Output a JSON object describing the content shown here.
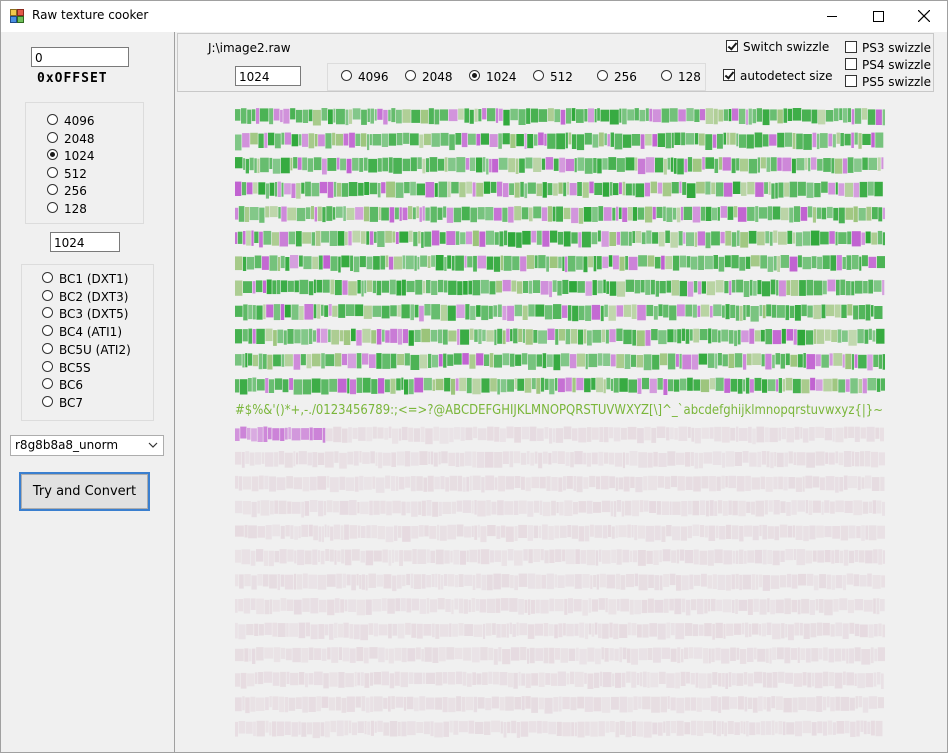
{
  "window": {
    "title": "Raw texture cooker"
  },
  "left": {
    "offset_value": "0",
    "offset_label": "0xOFFSET",
    "sizes": [
      "4096",
      "2048",
      "1024",
      "512",
      "256",
      "128"
    ],
    "selected_size": "1024",
    "size_value": "1024",
    "formats": [
      "BC1 (DXT1)",
      "BC2 (DXT3)",
      "BC3 (DXT5)",
      "BC4 (ATI1)",
      "BC5U (ATI2)",
      "BC5S",
      "BC6",
      "BC7"
    ],
    "pixel_format": "r8g8b8a8_unorm",
    "convert_label": "Try and Convert"
  },
  "top": {
    "path": "J:\\image2.raw",
    "size_value": "1024",
    "sizes": [
      "4096",
      "2048",
      "1024",
      "512",
      "256",
      "128"
    ],
    "selected_size": "1024",
    "switch_swizzle": {
      "label": "Switch swizzle",
      "checked": true
    },
    "autodetect": {
      "label": "autodetect size",
      "checked": true
    },
    "ps3": {
      "label": "PS3 swizzle",
      "checked": false
    },
    "ps4": {
      "label": "PS4 swizzle",
      "checked": false
    },
    "ps5": {
      "label": "PS5 swizzle",
      "checked": false
    }
  },
  "preview": {
    "visible_text": "#$%&'()*+,-./0123456789:;<=>?@ABCDEFGHIJKLMNOPQRSTUVWXYZ[\\]^_`abcdefghijklmnopqrstuvwxyz{|}~",
    "green": "#2fa83a",
    "magenta": "#c060d0",
    "faded": "#e3d5dc"
  }
}
